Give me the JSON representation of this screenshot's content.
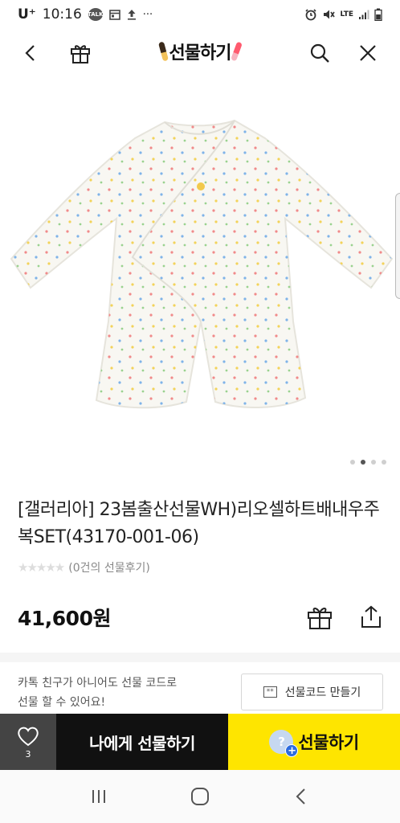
{
  "status_bar": {
    "carrier": "U⁺",
    "time": "10:16",
    "talk_badge": "TALK",
    "dots": "···",
    "network": "LTE"
  },
  "header": {
    "title": "선물하기"
  },
  "product": {
    "name": "[갤러리아] 23봄출산선물WH)리오셀하트배내우주복SET(43170-001-06)",
    "stars": "★★★★★",
    "review_text": "(0건의 선물후기)",
    "price": "41,600원"
  },
  "gift_code": {
    "text_line1": "카톡 친구가 아니어도 선물 코드로",
    "text_line2": "선물 할 수 있어요!",
    "button_label": "선물코드 만들기",
    "button_icon_text": "**"
  },
  "bottom_bar": {
    "wish_count": "3",
    "self_gift_label": "나에게 선물하기",
    "gift_label": "선물하기",
    "avatar_mark": "?",
    "plus_mark": "+"
  },
  "colors": {
    "accent": "#fee500",
    "dark": "#111111",
    "wish_bg": "#444444"
  },
  "icons": [
    "back-icon",
    "gift-icon",
    "search-icon",
    "close-icon",
    "heart-icon",
    "share-icon",
    "nav-recents-icon",
    "nav-home-icon",
    "nav-back-icon"
  ]
}
